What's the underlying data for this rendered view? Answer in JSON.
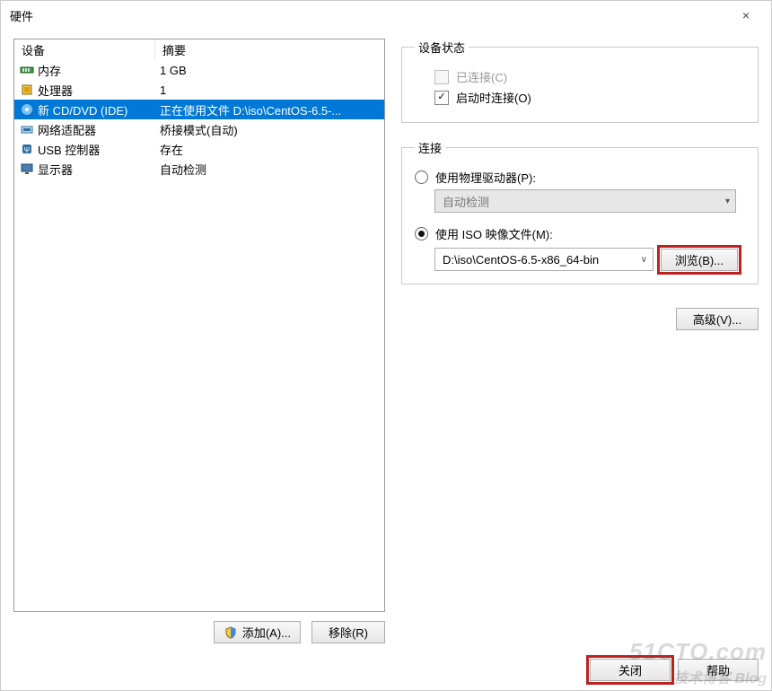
{
  "window": {
    "title": "硬件",
    "close": "×"
  },
  "left": {
    "headers": {
      "device": "设备",
      "summary": "摘要"
    },
    "rows": [
      {
        "icon": "memory-icon",
        "device": "内存",
        "summary": "1 GB",
        "selected": false
      },
      {
        "icon": "cpu-icon",
        "device": "处理器",
        "summary": "1",
        "selected": false
      },
      {
        "icon": "disc-icon",
        "device": "新 CD/DVD (IDE)",
        "summary": "正在使用文件 D:\\iso\\CentOS-6.5-...",
        "selected": true
      },
      {
        "icon": "network-icon",
        "device": "网络适配器",
        "summary": "桥接模式(自动)",
        "selected": false
      },
      {
        "icon": "usb-icon",
        "device": "USB 控制器",
        "summary": "存在",
        "selected": false
      },
      {
        "icon": "display-icon",
        "device": "显示器",
        "summary": "自动检测",
        "selected": false
      }
    ],
    "buttons": {
      "add": "添加(A)...",
      "remove": "移除(R)"
    }
  },
  "right": {
    "status": {
      "legend": "设备状态",
      "connected": {
        "label": "已连接(C)",
        "checked": false,
        "enabled": false
      },
      "connect_at_power": {
        "label": "启动时连接(O)",
        "checked": true,
        "enabled": true
      }
    },
    "connection": {
      "legend": "连接",
      "physical": {
        "label": "使用物理驱动器(P):",
        "selected": false,
        "value": "自动检测"
      },
      "iso": {
        "label": "使用 ISO 映像文件(M):",
        "selected": true,
        "value": "D:\\iso\\CentOS-6.5-x86_64-bin"
      },
      "browse": "浏览(B)..."
    },
    "advanced": "高级(V)..."
  },
  "footer": {
    "close": "关闭",
    "help": "帮助"
  },
  "watermark": {
    "main": "51CTO.com",
    "sub": "技术博客 Blog"
  }
}
